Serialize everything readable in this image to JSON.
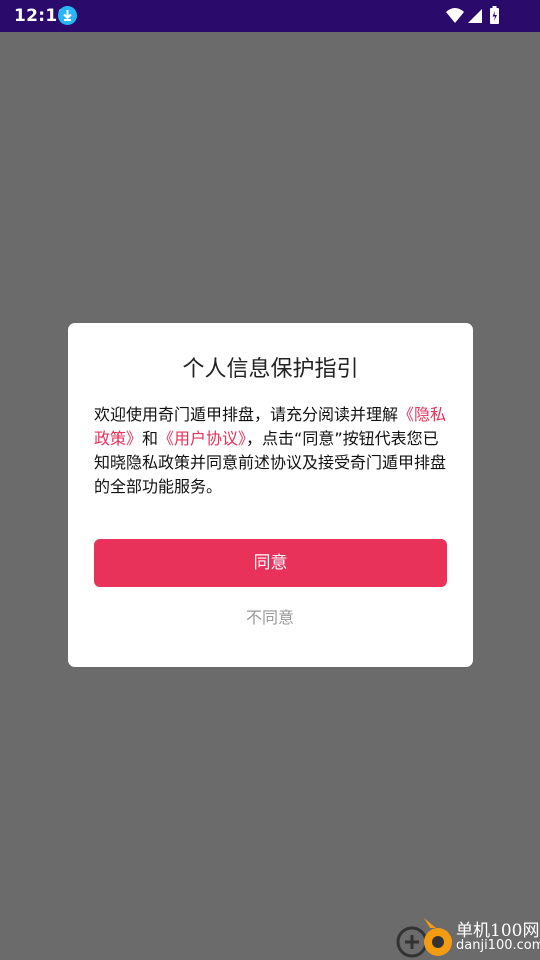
{
  "status_bar": {
    "time": "12:18",
    "icons": [
      "download-icon",
      "wifi-icon",
      "signal-icon",
      "battery-icon"
    ]
  },
  "dialog": {
    "title": "个人信息保护指引",
    "body": {
      "intro": "欢迎使用奇门遁甲排盘，请充分阅读并理解",
      "privacy_link": "《隐私政策》",
      "and": "和",
      "user_agreement_link": "《用户协议》",
      "rest": "，点击“同意”按钮代表您已知晓隐私政策并同意前述协议及接受奇门遁甲排盘的全部功能服务。"
    },
    "agree_label": "同意",
    "disagree_label": "不同意"
  },
  "watermark": {
    "title": "单机100网",
    "url": "danji100.com"
  },
  "colors": {
    "status_bar": "#2a0a6b",
    "overlay": "#6b6b6b",
    "accent": "#e8325a",
    "muted_text": "#999999"
  }
}
